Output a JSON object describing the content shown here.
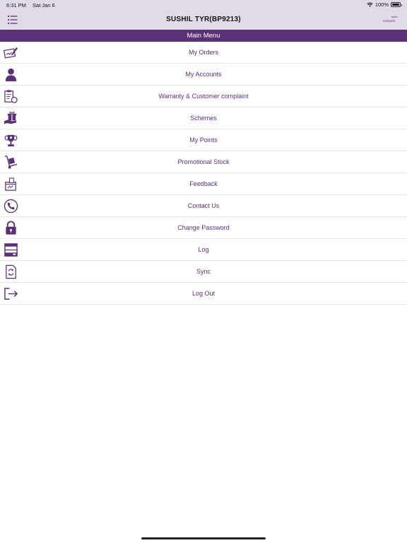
{
  "status_bar": {
    "time": "6:31 PM",
    "date": "Sat Jan 6",
    "battery": "100%"
  },
  "nav": {
    "title": "SUSHIL TYR(BP9213)",
    "logo_text": "sampark",
    "logo_top": "apollo"
  },
  "section": {
    "title": "Main Menu"
  },
  "menu": {
    "items": [
      {
        "label": "My Orders",
        "icon": "order-form-icon"
      },
      {
        "label": "My Accounts",
        "icon": "user-icon"
      },
      {
        "label": "Warranty & Customer complaint",
        "icon": "clipboard-search-icon"
      },
      {
        "label": "Schemes",
        "icon": "gift-hand-icon"
      },
      {
        "label": "My Points",
        "icon": "trophy-icon"
      },
      {
        "label": "Promotional Stock",
        "icon": "hand-truck-icon"
      },
      {
        "label": "Feedback",
        "icon": "feedback-box-icon"
      },
      {
        "label": "Contact Us",
        "icon": "phone-icon"
      },
      {
        "label": "Change Password",
        "icon": "lock-icon"
      },
      {
        "label": "Log",
        "icon": "log-list-icon"
      },
      {
        "label": "Sync",
        "icon": "sync-document-icon"
      },
      {
        "label": "Log Out",
        "icon": "logout-icon"
      }
    ]
  },
  "colors": {
    "accent": "#5a3177",
    "nav_bg": "#e2dbe7",
    "divider": "#e4e1e8"
  }
}
